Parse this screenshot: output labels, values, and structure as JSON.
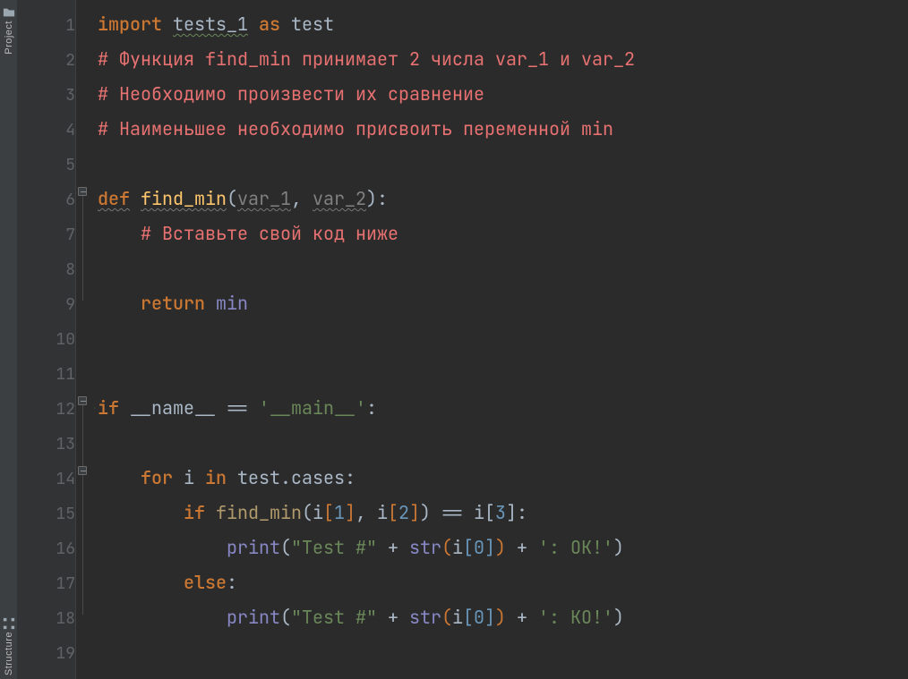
{
  "toolwindow": {
    "project_label": "Project",
    "structure_label": "Structure"
  },
  "gutter": {
    "line_numbers": [
      "1",
      "2",
      "3",
      "4",
      "5",
      "6",
      "7",
      "8",
      "9",
      "10",
      "11",
      "12",
      "13",
      "14",
      "15",
      "16",
      "17",
      "18",
      "19"
    ],
    "run_marker_line": 12
  },
  "code": {
    "lines": [
      {
        "n": 1,
        "tokens": [
          [
            "kw",
            "import"
          ],
          [
            "sp",
            " "
          ],
          [
            "ident wavy-green",
            "tests_1"
          ],
          [
            "sp",
            " "
          ],
          [
            "kw",
            "as"
          ],
          [
            "sp",
            " "
          ],
          [
            "ident",
            "test"
          ]
        ]
      },
      {
        "n": 2,
        "tokens": [
          [
            "comment",
            "# Функция find_min принимает 2 числа var_1 и var_2"
          ]
        ]
      },
      {
        "n": 3,
        "tokens": [
          [
            "comment",
            "# Необходимо произвести их сравнение"
          ]
        ]
      },
      {
        "n": 4,
        "tokens": [
          [
            "comment",
            "# Наименьшее необходимо присвоить переменной min"
          ]
        ]
      },
      {
        "n": 5,
        "tokens": []
      },
      {
        "n": 6,
        "tokens": [
          [
            "kw wavy-gray",
            "def"
          ],
          [
            "sp",
            " "
          ],
          [
            "fn wavy-gray",
            "find_min"
          ],
          [
            "bracket0",
            "("
          ],
          [
            "param wavy-gray",
            "var_1"
          ],
          [
            "op",
            ", "
          ],
          [
            "param wavy-gray",
            "var_2"
          ],
          [
            "bracket0",
            ")"
          ],
          [
            "op",
            ":"
          ]
        ]
      },
      {
        "n": 7,
        "indent": 1,
        "tokens": [
          [
            "comment",
            "# Вставьте свой код ниже"
          ]
        ]
      },
      {
        "n": 8,
        "indent": 1,
        "tokens": []
      },
      {
        "n": 9,
        "indent": 1,
        "tokens": [
          [
            "kw",
            "return"
          ],
          [
            "sp",
            " "
          ],
          [
            "builtin",
            "min"
          ]
        ]
      },
      {
        "n": 10,
        "tokens": []
      },
      {
        "n": 11,
        "tokens": []
      },
      {
        "n": 12,
        "tokens": [
          [
            "kw",
            "if"
          ],
          [
            "sp",
            " "
          ],
          [
            "ident",
            "__name__"
          ],
          [
            "sp",
            " "
          ],
          [
            "op",
            "=="
          ],
          [
            "sp",
            " "
          ],
          [
            "str",
            "'__main__'"
          ],
          [
            "op",
            ":"
          ]
        ]
      },
      {
        "n": 13,
        "indent": 1,
        "tokens": []
      },
      {
        "n": 14,
        "indent": 1,
        "tokens": [
          [
            "kw",
            "for"
          ],
          [
            "sp",
            " "
          ],
          [
            "ident",
            "i"
          ],
          [
            "sp",
            " "
          ],
          [
            "kw",
            "in"
          ],
          [
            "sp",
            " "
          ],
          [
            "ident",
            "test.cases"
          ],
          [
            "op",
            ":"
          ]
        ]
      },
      {
        "n": 15,
        "indent": 2,
        "tokens": [
          [
            "kw",
            "if"
          ],
          [
            "sp",
            " "
          ],
          [
            "call",
            "find_min"
          ],
          [
            "bracket0",
            "("
          ],
          [
            "ident",
            "i"
          ],
          [
            "bracket1",
            "["
          ],
          [
            "num",
            "1"
          ],
          [
            "bracket1",
            "]"
          ],
          [
            "op",
            ", "
          ],
          [
            "ident",
            "i"
          ],
          [
            "bracket1",
            "["
          ],
          [
            "num",
            "2"
          ],
          [
            "bracket1",
            "]"
          ],
          [
            "bracket0",
            ")"
          ],
          [
            "sp",
            " "
          ],
          [
            "op",
            "=="
          ],
          [
            "sp",
            " "
          ],
          [
            "ident",
            "i"
          ],
          [
            "bracket0",
            "["
          ],
          [
            "num",
            "3"
          ],
          [
            "bracket0",
            "]"
          ],
          [
            "op",
            ":"
          ]
        ]
      },
      {
        "n": 16,
        "indent": 3,
        "tokens": [
          [
            "builtin",
            "print"
          ],
          [
            "bracket0",
            "("
          ],
          [
            "str",
            "\"Test #\""
          ],
          [
            "sp",
            " "
          ],
          [
            "op",
            "+"
          ],
          [
            "sp",
            " "
          ],
          [
            "builtin",
            "str"
          ],
          [
            "bracket1",
            "("
          ],
          [
            "ident",
            "i"
          ],
          [
            "bracket2",
            "["
          ],
          [
            "num",
            "0"
          ],
          [
            "bracket2",
            "]"
          ],
          [
            "bracket1",
            ")"
          ],
          [
            "sp",
            " "
          ],
          [
            "op",
            "+"
          ],
          [
            "sp",
            " "
          ],
          [
            "str",
            "': OK!'"
          ],
          [
            "bracket0",
            ")"
          ]
        ]
      },
      {
        "n": 17,
        "indent": 2,
        "tokens": [
          [
            "kw",
            "else"
          ],
          [
            "op",
            ":"
          ]
        ]
      },
      {
        "n": 18,
        "indent": 3,
        "tokens": [
          [
            "builtin",
            "print"
          ],
          [
            "bracket0",
            "("
          ],
          [
            "str",
            "\"Test #\""
          ],
          [
            "sp",
            " "
          ],
          [
            "op",
            "+"
          ],
          [
            "sp",
            " "
          ],
          [
            "builtin",
            "str"
          ],
          [
            "bracket1",
            "("
          ],
          [
            "ident",
            "i"
          ],
          [
            "bracket2",
            "["
          ],
          [
            "num",
            "0"
          ],
          [
            "bracket2",
            "]"
          ],
          [
            "bracket1",
            ")"
          ],
          [
            "sp",
            " "
          ],
          [
            "op",
            "+"
          ],
          [
            "sp",
            " "
          ],
          [
            "str",
            "': KO!'"
          ],
          [
            "bracket0",
            ")"
          ]
        ]
      },
      {
        "n": 19,
        "tokens": []
      }
    ]
  }
}
